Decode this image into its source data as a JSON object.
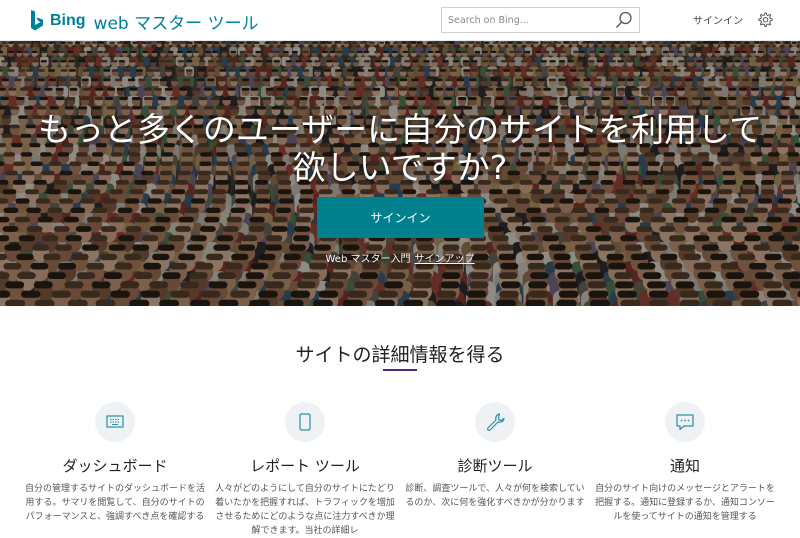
{
  "header": {
    "logo_brand": "Bing",
    "logo_title": "web マスター ツール",
    "search_placeholder": "Search on Bing...",
    "signin": "サインイン",
    "icons": {
      "logo": "bing-logo-icon",
      "search": "search-icon",
      "settings": "gear-icon"
    }
  },
  "hero": {
    "title_line1": "もっと多くのユーザーに自分のサイトを利用して",
    "title_line2": "欲しいですか?",
    "signin_button": "サインイン",
    "sub_prefix": "Web マスター入門",
    "sub_link": "サインアップ"
  },
  "section": {
    "title": "サイトの詳細情報を得る",
    "accent_color": "#4b2a7b"
  },
  "features": [
    {
      "icon": "dashboard-icon",
      "title": "ダッシュボード",
      "desc": "自分の管理するサイトのダッシュボードを活用する。サマリを閲覧して、自分のサイトのパフォーマンスと、強調すべき点を確認する"
    },
    {
      "icon": "report-icon",
      "title": "レポート ツール",
      "desc": "人々がどのようにして自分のサイトにたどり着いたかを把握すれば、トラフィックを増加させるためにどのような点に注力すべきか理解できます。当社の詳細レ"
    },
    {
      "icon": "wrench-icon",
      "title": "診断ツール",
      "desc": "診断、調査ツールで、人々が何を検索しているのか、次に何を強化すべきかが分かります"
    },
    {
      "icon": "message-icon",
      "title": "通知",
      "desc": "自分のサイト向けのメッセージとアラートを把握する。通知に登録するか、通知コンソールを使ってサイトの通知を管理する"
    }
  ],
  "colors": {
    "brand": "#00809d",
    "button": "#00808d"
  }
}
